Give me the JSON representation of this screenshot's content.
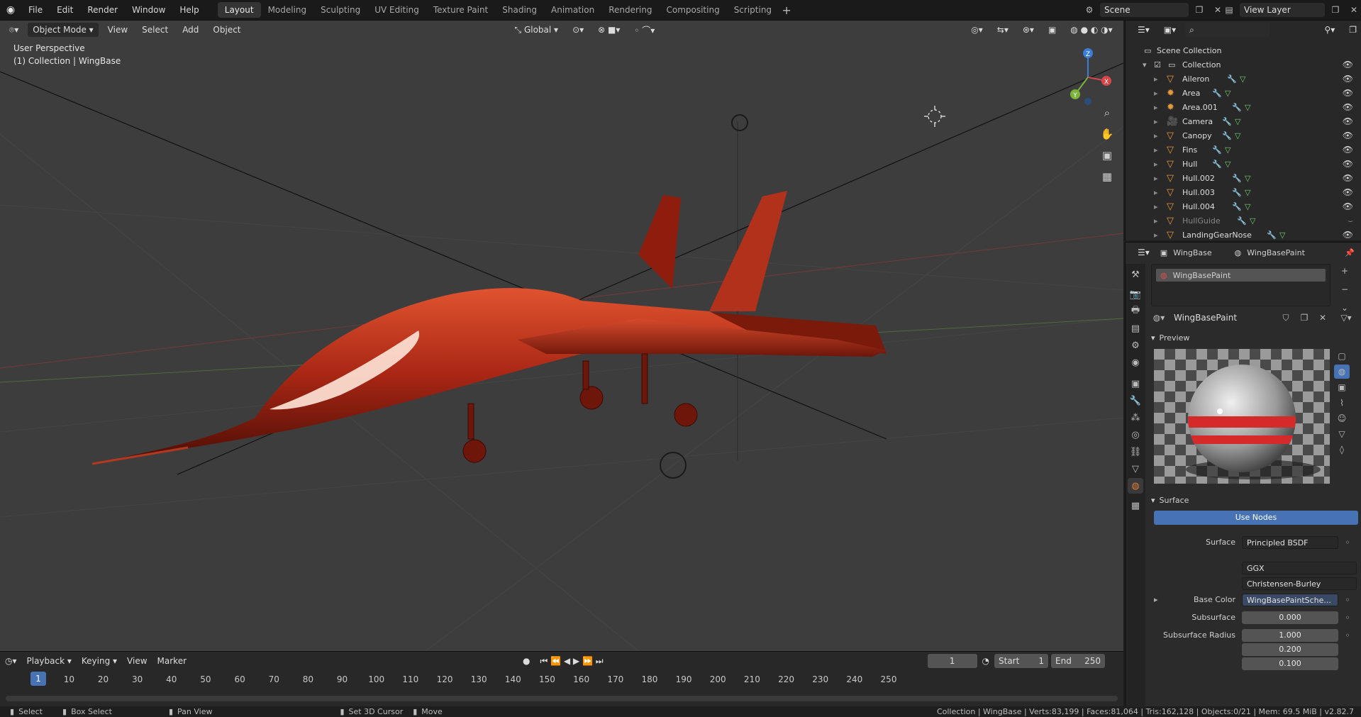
{
  "menus": [
    "File",
    "Edit",
    "Render",
    "Window",
    "Help"
  ],
  "workspaces": [
    "Layout",
    "Modeling",
    "Sculpting",
    "UV Editing",
    "Texture Paint",
    "Shading",
    "Animation",
    "Rendering",
    "Compositing",
    "Scripting"
  ],
  "active_workspace": "Layout",
  "scene_field": "Scene",
  "view_layer_field": "View Layer",
  "viewport": {
    "mode": "Object Mode",
    "menu_view": "View",
    "menu_select": "Select",
    "menu_add": "Add",
    "menu_object": "Object",
    "transform_orientation": "Global",
    "overlay_line1": "User Perspective",
    "overlay_line2": "(1) Collection | WingBase",
    "gizmo_axes": [
      "X",
      "Y",
      "Z"
    ],
    "object_color": "#c0321e"
  },
  "timeline": {
    "menu_playback": "Playback",
    "menu_keying": "Keying",
    "menu_view": "View",
    "menu_marker": "Marker",
    "current_frame": "1",
    "start_label": "Start",
    "start_value": "1",
    "end_label": "End",
    "end_value": "250",
    "ruler_ticks": [
      "1",
      "10",
      "20",
      "30",
      "40",
      "50",
      "60",
      "70",
      "80",
      "90",
      "100",
      "110",
      "120",
      "130",
      "140",
      "150",
      "160",
      "170",
      "180",
      "190",
      "200",
      "210",
      "220",
      "230",
      "240",
      "250"
    ]
  },
  "statusbar": {
    "select": "Select",
    "box_select": "Box Select",
    "pan_view": "Pan View",
    "set_cursor": "Set 3D Cursor",
    "move": "Move",
    "stats": "Collection | WingBase | Verts:83,199 | Faces:81,064 | Tris:162,128 | Objects:0/21 | Mem: 69.5 MiB | v2.82.7"
  },
  "outliner": {
    "root": "Scene Collection",
    "collection": "Collection",
    "items": [
      {
        "name": "Aileron",
        "type": "mesh"
      },
      {
        "name": "Area",
        "type": "light"
      },
      {
        "name": "Area.001",
        "type": "light"
      },
      {
        "name": "Camera",
        "type": "camera"
      },
      {
        "name": "Canopy",
        "type": "mesh"
      },
      {
        "name": "Fins",
        "type": "mesh"
      },
      {
        "name": "Hull",
        "type": "mesh"
      },
      {
        "name": "Hull.002",
        "type": "mesh"
      },
      {
        "name": "Hull.003",
        "type": "mesh"
      },
      {
        "name": "Hull.004",
        "type": "mesh"
      },
      {
        "name": "HullGuide",
        "type": "mesh"
      },
      {
        "name": "LandingGearNose",
        "type": "mesh"
      }
    ]
  },
  "properties": {
    "object_name": "WingBase",
    "material_name": "WingBasePaint",
    "slot_name": "WingBasePaint",
    "material_field": "WingBasePaint",
    "preview_title": "Preview",
    "surface_title": "Surface",
    "use_nodes": "Use Nodes",
    "surface_label": "Surface",
    "surface_value": "Principled BSDF",
    "distribution": "GGX",
    "subsurface_method": "Christensen-Burley",
    "base_color_label": "Base Color",
    "base_color_value": "WingBasePaintSche...",
    "subsurface_label": "Subsurface",
    "subsurface_value": "0.000",
    "subsurface_radius_label": "Subsurface Radius",
    "subsurface_radius": [
      "1.000",
      "0.200",
      "0.100"
    ]
  }
}
